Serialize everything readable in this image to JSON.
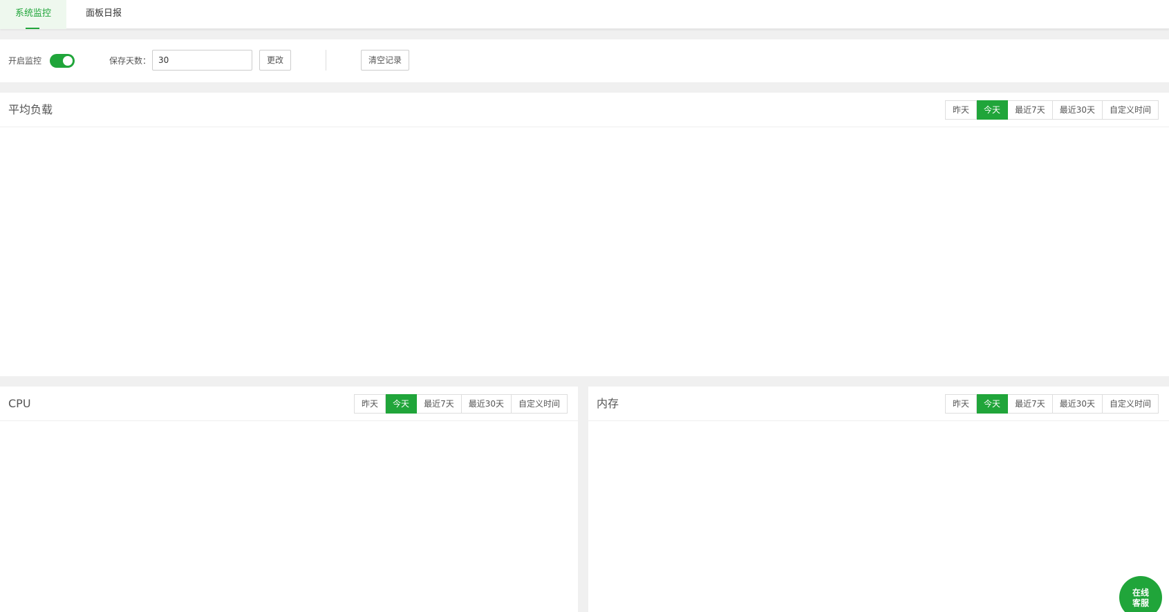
{
  "tabs": [
    {
      "label": "系统监控",
      "active": true
    },
    {
      "label": "面板日报",
      "active": false
    }
  ],
  "settings": {
    "monitor_label": "开启监控",
    "monitor_enabled": true,
    "days_label": "保存天数：",
    "days_value": "30",
    "change_label": "更改",
    "clear_label": "清空记录"
  },
  "range_options": [
    "昨天",
    "今天",
    "最近7天",
    "最近30天",
    "自定义时间"
  ],
  "selected_range": "今天",
  "panels": {
    "load": {
      "title": "平均负载"
    },
    "cpu": {
      "title": "CPU"
    },
    "memory": {
      "title": "内存"
    }
  },
  "service": {
    "line1": "在线",
    "line2": "客服"
  },
  "colors": {
    "accent": "#20a53a"
  }
}
